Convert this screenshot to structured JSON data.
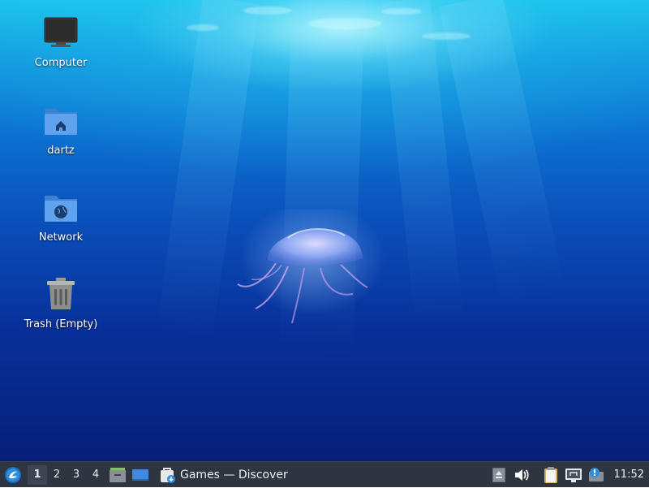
{
  "desktop": {
    "icons": [
      {
        "label": "Computer",
        "icon": "computer-icon"
      },
      {
        "label": "dartz",
        "icon": "home-folder-icon"
      },
      {
        "label": "Network",
        "icon": "network-folder-icon"
      },
      {
        "label": "Trash (Empty)",
        "icon": "trash-icon"
      }
    ]
  },
  "taskbar": {
    "start_icon": "lubuntu-menu-icon",
    "workspaces": [
      "1",
      "2",
      "3",
      "4"
    ],
    "active_workspace": "1",
    "launchers": [
      "file-manager-icon",
      "show-desktop-icon"
    ],
    "tasks": [
      {
        "title": "Games — Discover",
        "icon": "discover-icon"
      }
    ],
    "tray": [
      "eject-icon",
      "volume-icon",
      "clipboard-icon",
      "network-wired-icon",
      "update-notifier-icon"
    ],
    "clock": "11:52"
  },
  "colors": {
    "panel_bg": "#2e3541",
    "accent": "#2f8fdc"
  }
}
